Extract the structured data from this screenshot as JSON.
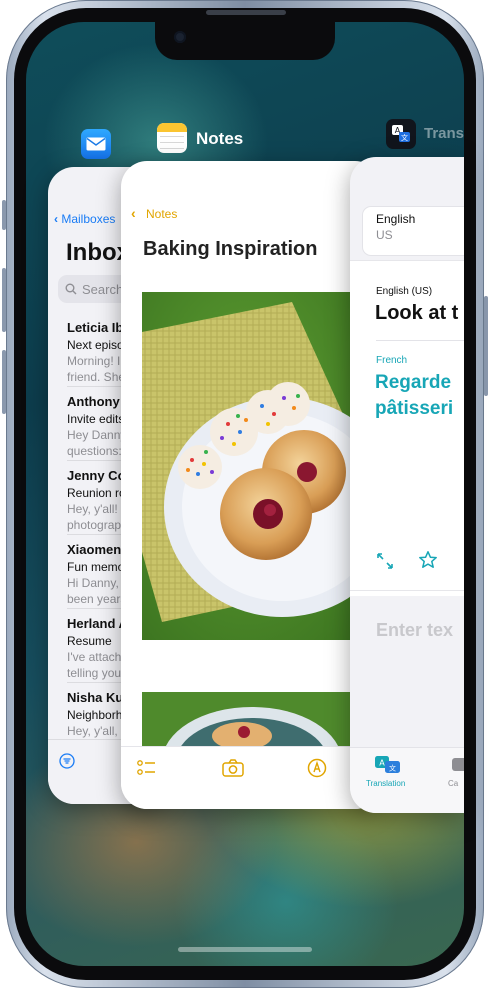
{
  "switcher": {
    "apps": [
      {
        "name": "",
        "icon": "mail-icon"
      },
      {
        "name": "Notes",
        "icon": "notes-icon"
      },
      {
        "name": "Trans",
        "icon": "translate-icon"
      }
    ]
  },
  "mail": {
    "back_label": "Mailboxes",
    "title": "Inbox",
    "search_placeholder": "Search",
    "messages": [
      {
        "sender": "Leticia Iba",
        "subject": "Next episo",
        "preview1": "Morning! I",
        "preview2": "friend. She"
      },
      {
        "sender": "Anthony W",
        "subject": "Invite edits",
        "preview1": "Hey Danny",
        "preview2": "questions:"
      },
      {
        "sender": "Jenny Co",
        "subject": "Reunion ro",
        "preview1": "Hey, y'all!",
        "preview2": "photograph"
      },
      {
        "sender": "Xiaomeng",
        "subject": "Fun memor",
        "preview1": "Hi Danny, F",
        "preview2": "been years"
      },
      {
        "sender": "Herland A",
        "subject": "Resume",
        "preview1": "I've attach",
        "preview2": "telling you"
      },
      {
        "sender": "Nisha Ku",
        "subject": "Neighborh",
        "preview1": "Hey, y'all,",
        "preview2": ""
      }
    ]
  },
  "notes": {
    "back_label": "Notes",
    "title": "Baking Inspiration"
  },
  "translate": {
    "input_language": "English",
    "input_region": "US",
    "source_language_label": "English (US)",
    "source_text": "Look at t",
    "target_language_label": "French",
    "target_text_line1": "Regarde",
    "target_text_line2": "pâtisseri",
    "input_placeholder": "Enter tex",
    "tab_translation": "Translation",
    "tab_camera": "Ca"
  },
  "colors": {
    "mail_accent": "#1a7cf5",
    "notes_accent": "#e1a500",
    "translate_accent": "#17a6b6"
  }
}
